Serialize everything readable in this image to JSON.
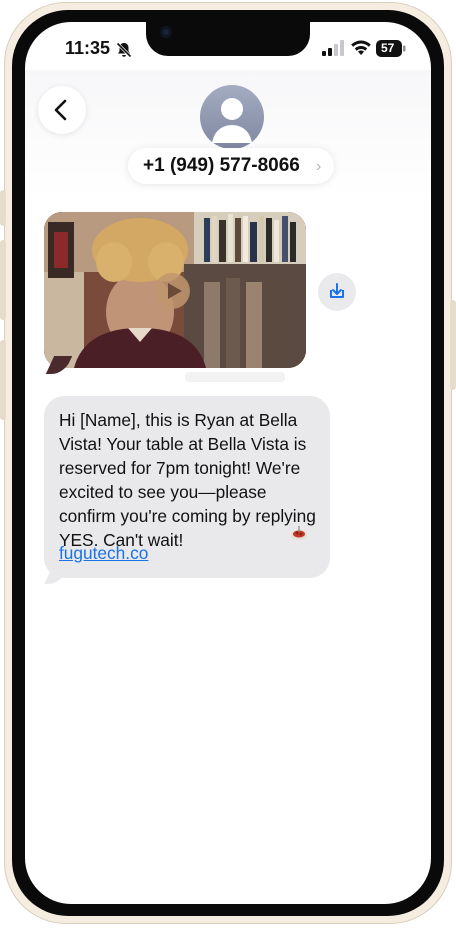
{
  "status_bar": {
    "time": "11:35",
    "battery": "57"
  },
  "header": {
    "contact_number": "+1 (949) 577-8066",
    "chevron": "›"
  },
  "messages": {
    "text": "Hi [Name], this is Ryan at Bella Vista!  Your table at Bella Vista is reserved for 7pm tonight! We're excited to see you—please confirm you're coming by replying YES. Can't wait!",
    "link": "fugutech.co",
    "emoji_icon": "spaghetti-icon"
  },
  "icons": {
    "back": "chevron-left-icon",
    "avatar": "person-avatar-icon",
    "play": "play-icon",
    "save": "download-icon"
  },
  "colors": {
    "bubble": "#e9e9eb",
    "link": "#1a73e8",
    "avatar": "#8f97b0"
  }
}
